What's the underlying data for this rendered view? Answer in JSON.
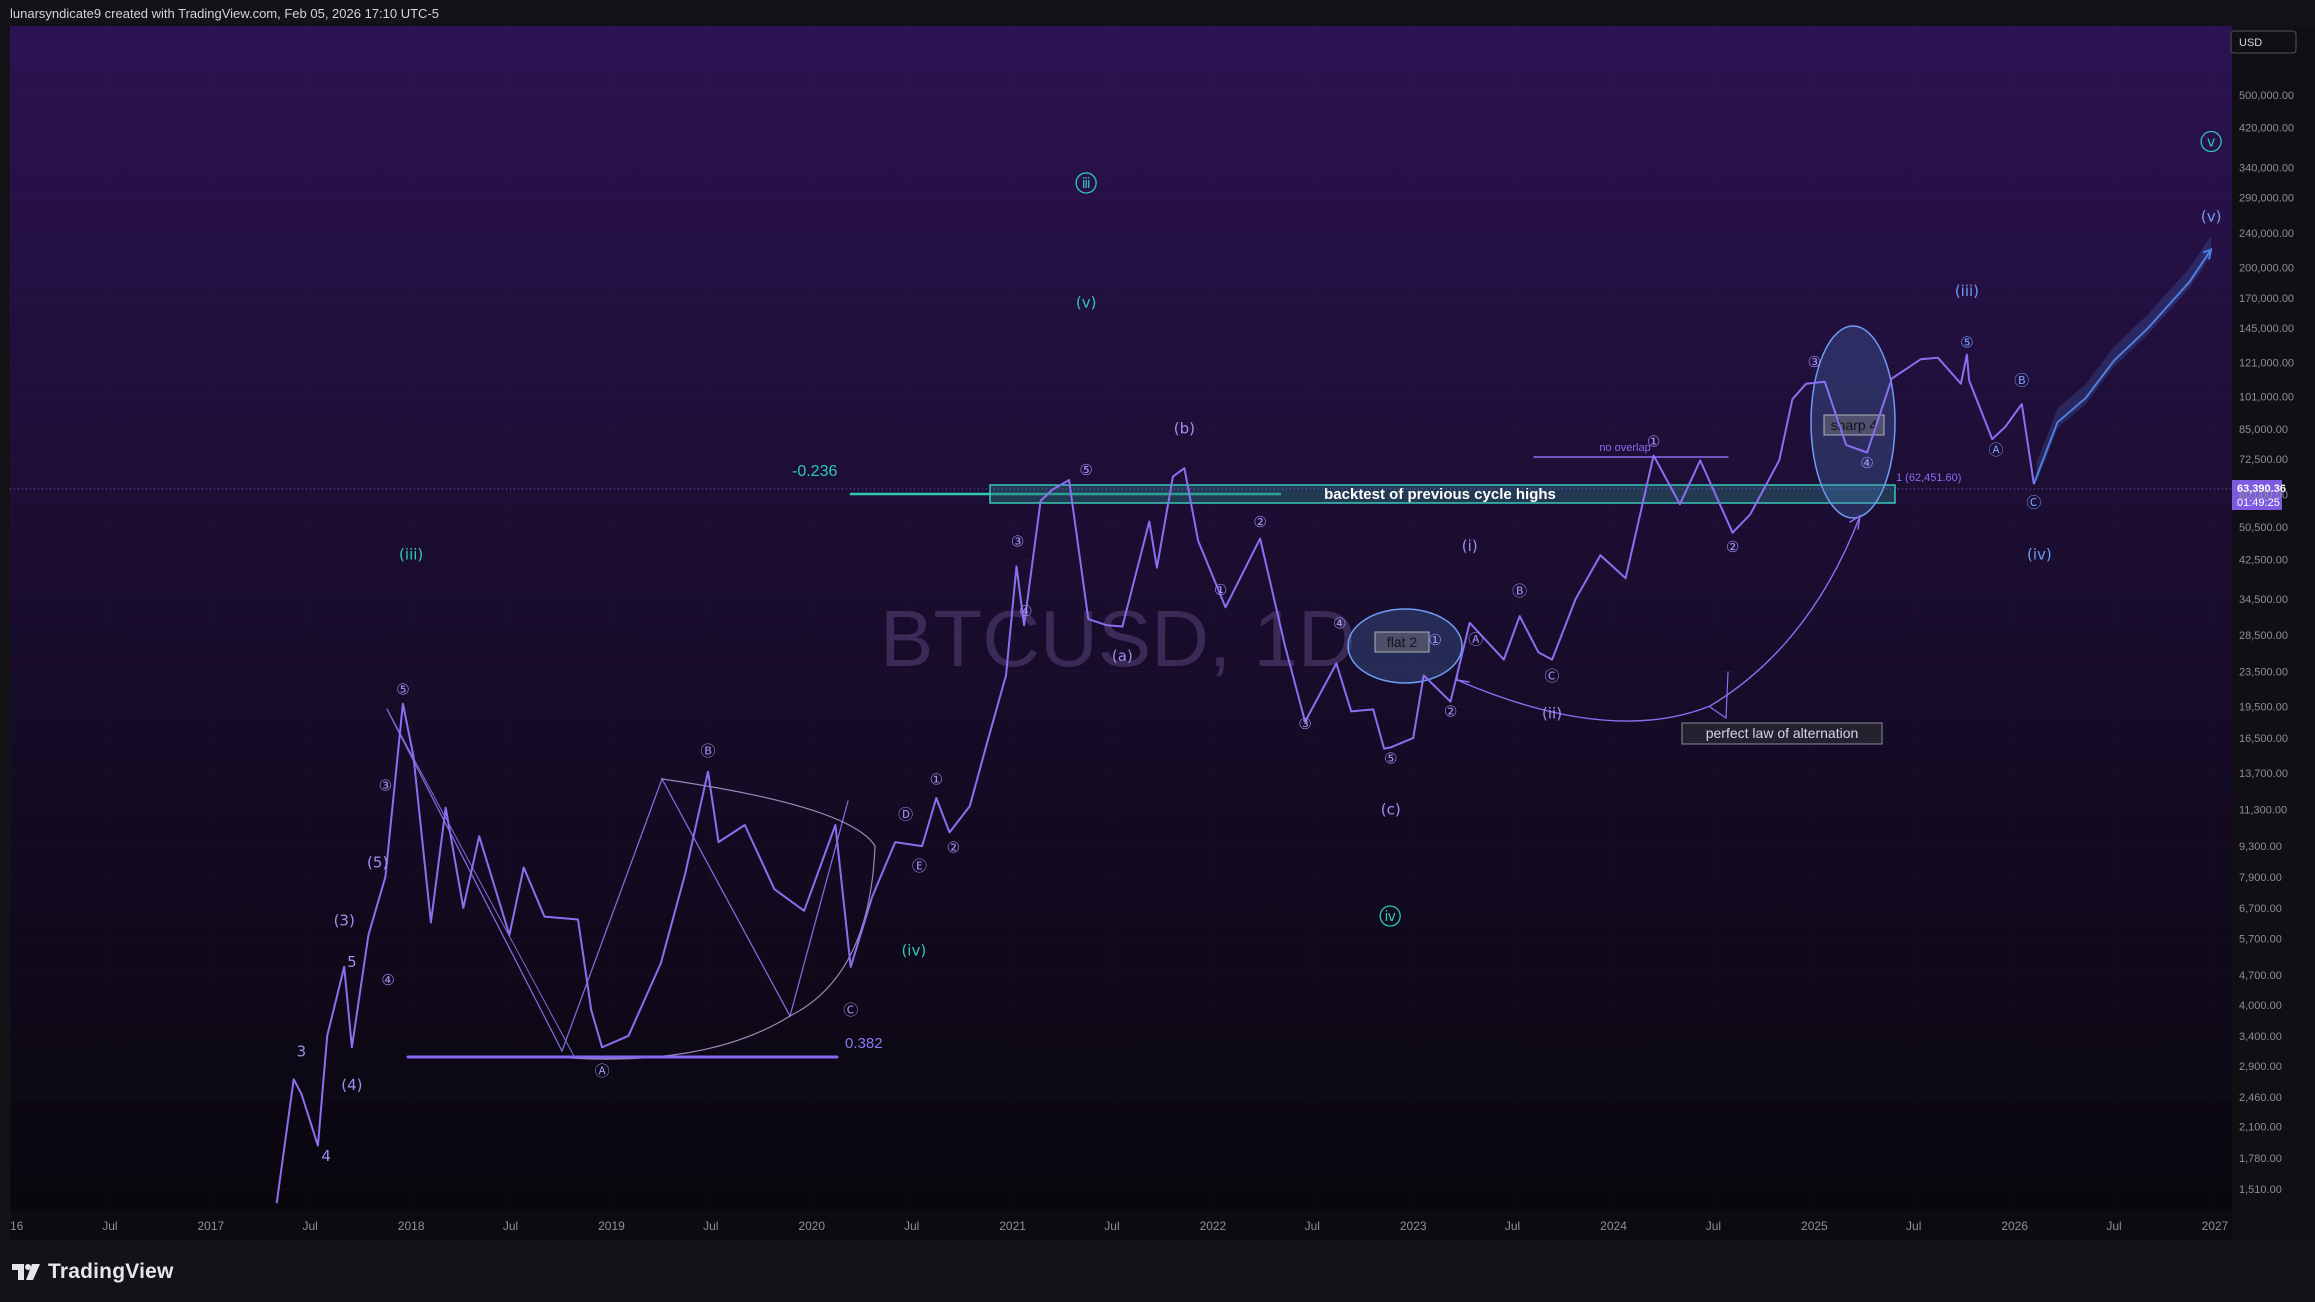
{
  "header": {
    "attribution": "lunarsyndicate9 created with TradingView.com, Feb 05, 2026 17:10 UTC-5"
  },
  "footer": {
    "brand": "TradingView"
  },
  "colors": {
    "bg_top": "#2c1252",
    "bg_bottom": "#08060c",
    "price_line": "#8a6ff0",
    "wave_purple": "#a08ef0",
    "wave_teal": "#2fc9b2",
    "wave_blue": "#6f9cf3",
    "price_badge": "#7c5be0",
    "ticker_watermark": "#3a2a55"
  },
  "chart_data": {
    "type": "line",
    "title": "BTCUSD, 1D",
    "currency": "USD",
    "y_scale": "log",
    "ylim": [
      1350,
      720000
    ],
    "x_range": [
      "2016-01-01",
      "2027-02-01"
    ],
    "x_tick_labels": [
      "2016",
      "Jul",
      "2017",
      "Jul",
      "2018",
      "Jul",
      "2019",
      "Jul",
      "2020",
      "Jul",
      "2021",
      "Jul",
      "2022",
      "Jul",
      "2023",
      "Jul",
      "2024",
      "Jul",
      "2025",
      "Jul",
      "2026",
      "Jul",
      "2027"
    ],
    "x_tick_dates": [
      "2016-01-01",
      "2016-07-01",
      "2017-01-01",
      "2017-07-01",
      "2018-01-01",
      "2018-07-01",
      "2019-01-01",
      "2019-07-01",
      "2020-01-01",
      "2020-07-01",
      "2021-01-01",
      "2021-07-01",
      "2022-01-01",
      "2022-07-01",
      "2023-01-01",
      "2023-07-01",
      "2024-01-01",
      "2024-07-01",
      "2025-01-01",
      "2025-07-01",
      "2026-01-01",
      "2026-07-01",
      "2027-01-01"
    ],
    "y_tick_labels": [
      "500,000.00",
      "420,000.00",
      "340,000.00",
      "290,000.00",
      "240,000.00",
      "200,000.00",
      "170,000.00",
      "145,000.00",
      "121,000.00",
      "101,000.00",
      "85,000.00",
      "72,500.00",
      "60,000.00",
      "50,500.00",
      "42,500.00",
      "34,500.00",
      "28,500.00",
      "23,500.00",
      "19,500.00",
      "16,500.00",
      "13,700.00",
      "11,300.00",
      "9,300.00",
      "7,900.00",
      "6,700.00",
      "5,700.00",
      "4,700.00",
      "4,000.00",
      "3,400.00",
      "2,900.00",
      "2,460.00",
      "2,100.00",
      "1,780.00",
      "1,510.00"
    ],
    "y_tick_values": [
      500000,
      420000,
      340000,
      290000,
      240000,
      200000,
      170000,
      145000,
      121000,
      101000,
      85000,
      72500,
      60000,
      50500,
      42500,
      34500,
      28500,
      23500,
      19500,
      16500,
      13700,
      11300,
      9300,
      7900,
      6700,
      5700,
      4700,
      4000,
      3400,
      2900,
      2460,
      2100,
      1780,
      1510
    ],
    "last_price": {
      "value": 63390.36,
      "label": "63,390.36",
      "countdown": "01:49:25"
    },
    "series": [
      {
        "dates": [
          "2017-05-01",
          "2017-06-01",
          "2017-06-15",
          "2017-07-15",
          "2017-08-01",
          "2017-09-01",
          "2017-09-15",
          "2017-10-15",
          "2017-11-15",
          "2017-12-17",
          "2018-01-05",
          "2018-02-06",
          "2018-03-05",
          "2018-04-06",
          "2018-05-05",
          "2018-06-29",
          "2018-07-25",
          "2018-09-01",
          "2018-11-01",
          "2018-11-25",
          "2018-12-15",
          "2019-02-01",
          "2019-04-01",
          "2019-05-15",
          "2019-06-26",
          "2019-07-15",
          "2019-09-01",
          "2019-10-25",
          "2019-12-18",
          "2020-02-13",
          "2020-03-12",
          "2020-04-20",
          "2020-06-01",
          "2020-07-20",
          "2020-08-15",
          "2020-09-08",
          "2020-10-15",
          "2020-11-15",
          "2020-12-20",
          "2021-01-08",
          "2021-01-22",
          "2021-02-21",
          "2021-03-14",
          "2021-04-14",
          "2021-05-19",
          "2021-06-22",
          "2021-07-20",
          "2021-09-07",
          "2021-09-21",
          "2021-10-20",
          "2021-11-10",
          "2021-12-05",
          "2022-01-24",
          "2022-03-28",
          "2022-05-12",
          "2022-06-18",
          "2022-08-14",
          "2022-09-10",
          "2022-10-20",
          "2022-11-09",
          "2022-11-21",
          "2023-01-01",
          "2023-01-20",
          "2023-03-10",
          "2023-04-14",
          "2023-06-15",
          "2023-07-14",
          "2023-08-17",
          "2023-09-11",
          "2023-10-24",
          "2023-12-08",
          "2024-01-23",
          "2024-03-14",
          "2024-05-01",
          "2024-06-07",
          "2024-08-05",
          "2024-09-06",
          "2024-10-29",
          "2024-11-22",
          "2024-12-17",
          "2025-01-20",
          "2025-02-28",
          "2025-04-07",
          "2025-05-22",
          "2025-07-14",
          "2025-08-14",
          "2025-09-25",
          "2025-10-06",
          "2025-10-10",
          "2025-11-21",
          "2025-12-15",
          "2026-01-14",
          "2026-02-05"
        ],
        "values": [
          1400,
          2700,
          2500,
          1900,
          3400,
          4900,
          3200,
          5800,
          7900,
          19800,
          15000,
          6200,
          11400,
          6700,
          9800,
          5800,
          8300,
          6400,
          6300,
          3900,
          3200,
          3400,
          5000,
          8000,
          13800,
          9500,
          10400,
          7400,
          6600,
          10400,
          4900,
          7100,
          9500,
          9300,
          12000,
          10000,
          11500,
          16000,
          23000,
          41000,
          30000,
          58000,
          61500,
          64800,
          31000,
          30000,
          29800,
          52000,
          40700,
          66000,
          69000,
          47000,
          33000,
          47500,
          27000,
          18000,
          24500,
          19000,
          19200,
          15600,
          15700,
          16500,
          23000,
          20000,
          30400,
          25000,
          31500,
          26000,
          25000,
          34500,
          43500,
          38500,
          73800,
          57000,
          71900,
          49000,
          54000,
          72000,
          99500,
          108000,
          109100,
          78000,
          75000,
          111000,
          123000,
          124000,
          108000,
          126000,
          110000,
          80500,
          86000,
          97000,
          63390
        ]
      }
    ],
    "forecast_projection": {
      "dates": [
        "2026-02-10",
        "2026-03-20",
        "2026-05-10",
        "2026-07-01",
        "2026-09-01",
        "2026-11-15",
        "2026-12-25"
      ],
      "values": [
        66000,
        88000,
        100000,
        122000,
        145000,
        185000,
        220000
      ]
    },
    "levels": [
      {
        "label": "-0.236",
        "value": 62400
      },
      {
        "label": "0.382",
        "value": 3200
      },
      {
        "label": "1 (62,451.60)",
        "value": 62451.6
      }
    ],
    "annotations": [
      "backtest of previous cycle highs",
      "flat 2",
      "sharp 4",
      "no overlap",
      "perfect law of alternation"
    ],
    "wave_labels": [
      {
        "text": "ⅲ",
        "date": "2021-05-15",
        "value": 305000,
        "style": "circle",
        "color": "teal"
      },
      {
        "text": "(v)",
        "date": "2021-05-15",
        "value": 162000,
        "style": "plain",
        "color": "teal"
      },
      {
        "text": "(iii)",
        "date": "2018-01-01",
        "value": 42500,
        "style": "plain",
        "color": "teal"
      },
      {
        "text": "(iv)",
        "date": "2020-07-05",
        "value": 5200,
        "style": "plain",
        "color": "teal"
      },
      {
        "text": "ⅳ",
        "date": "2022-11-20",
        "value": 6250,
        "style": "circle",
        "color": "teal"
      },
      {
        "text": "ⅴ",
        "date": "2026-12-25",
        "value": 380000,
        "style": "circle",
        "color": "teal"
      },
      {
        "text": "(b)",
        "date": "2021-11-10",
        "value": 83000,
        "style": "plain",
        "color": "purple"
      },
      {
        "text": "(a)",
        "date": "2021-07-20",
        "value": 24800,
        "style": "plain",
        "color": "purple"
      },
      {
        "text": "(c)",
        "date": "2022-11-21",
        "value": 11000,
        "style": "plain",
        "color": "purple"
      },
      {
        "text": "(i)",
        "date": "2023-04-14",
        "value": 44500,
        "style": "plain",
        "color": "purple"
      },
      {
        "text": "(ii)",
        "date": "2023-09-11",
        "value": 18300,
        "style": "plain",
        "color": "purple"
      },
      {
        "text": "(iii)",
        "date": "2025-10-06",
        "value": 172000,
        "style": "plain",
        "color": "blue"
      },
      {
        "text": "(iv)",
        "date": "2026-02-15",
        "value": 42500,
        "style": "plain",
        "color": "blue"
      },
      {
        "text": "(v)",
        "date": "2026-12-25",
        "value": 255000,
        "style": "plain",
        "color": "blue"
      },
      {
        "text": "⑤",
        "date": "2017-12-17",
        "value": 20800,
        "style": "plain",
        "color": "purple"
      },
      {
        "text": "③",
        "date": "2017-11-15",
        "value": 12500,
        "style": "plain",
        "color": "purple"
      },
      {
        "text": "(5)",
        "date": "2017-11-01",
        "value": 8300,
        "style": "plain",
        "color": "purple"
      },
      {
        "text": "(3)",
        "date": "2017-09-01",
        "value": 6100,
        "style": "plain",
        "color": "purple"
      },
      {
        "text": "5",
        "date": "2017-09-15",
        "value": 4900,
        "style": "plain",
        "color": "purple"
      },
      {
        "text": "④",
        "date": "2017-11-20",
        "value": 4450,
        "style": "plain",
        "color": "purple"
      },
      {
        "text": "3",
        "date": "2017-06-15",
        "value": 3050,
        "style": "plain",
        "color": "purple"
      },
      {
        "text": "(4)",
        "date": "2017-09-15",
        "value": 2550,
        "style": "plain",
        "color": "purple"
      },
      {
        "text": "4",
        "date": "2017-07-30",
        "value": 1750,
        "style": "plain",
        "color": "purple"
      },
      {
        "text": "Ⓐ",
        "date": "2018-12-15",
        "value": 2750,
        "style": "plain",
        "color": "purple"
      },
      {
        "text": "Ⓑ",
        "date": "2019-06-26",
        "value": 15000,
        "style": "plain",
        "color": "purple"
      },
      {
        "text": "Ⓒ",
        "date": "2020-03-12",
        "value": 3800,
        "style": "plain",
        "color": "purple"
      },
      {
        "text": "Ⓓ",
        "date": "2020-06-20",
        "value": 10700,
        "style": "plain",
        "color": "purple"
      },
      {
        "text": "Ⓔ",
        "date": "2020-07-15",
        "value": 8150,
        "style": "plain",
        "color": "purple"
      },
      {
        "text": "①",
        "date": "2020-08-15",
        "value": 12900,
        "style": "plain",
        "color": "purple"
      },
      {
        "text": "②",
        "date": "2020-09-15",
        "value": 9000,
        "style": "plain",
        "color": "purple"
      },
      {
        "text": "③",
        "date": "2021-01-10",
        "value": 45500,
        "style": "plain",
        "color": "purple"
      },
      {
        "text": "④",
        "date": "2021-01-25",
        "value": 31500,
        "style": "plain",
        "color": "purple"
      },
      {
        "text": "⑤",
        "date": "2021-05-15",
        "value": 66500,
        "style": "plain",
        "color": "purple"
      },
      {
        "text": "②",
        "date": "2022-03-28",
        "value": 50500,
        "style": "plain",
        "color": "purple"
      },
      {
        "text": "①",
        "date": "2022-01-15",
        "value": 35200,
        "style": "plain",
        "color": "purple"
      },
      {
        "text": "③",
        "date": "2022-06-18",
        "value": 17300,
        "style": "plain",
        "color": "purple"
      },
      {
        "text": "④",
        "date": "2022-08-20",
        "value": 29500,
        "style": "plain",
        "color": "purple"
      },
      {
        "text": "⑤",
        "date": "2022-11-21",
        "value": 14400,
        "style": "plain",
        "color": "purple"
      },
      {
        "text": "②",
        "date": "2023-03-10",
        "value": 18500,
        "style": "plain",
        "color": "purple"
      },
      {
        "text": "①",
        "date": "2023-02-10",
        "value": 27000,
        "style": "plain",
        "color": "purple"
      },
      {
        "text": "Ⓐ",
        "date": "2023-04-25",
        "value": 27100,
        "style": "plain",
        "color": "purple"
      },
      {
        "text": "Ⓑ",
        "date": "2023-07-14",
        "value": 35000,
        "style": "plain",
        "color": "purple"
      },
      {
        "text": "Ⓒ",
        "date": "2023-09-11",
        "value": 22300,
        "style": "plain",
        "color": "purple"
      },
      {
        "text": "①",
        "date": "2024-03-14",
        "value": 77500,
        "style": "plain",
        "color": "purple"
      },
      {
        "text": "②",
        "date": "2024-08-05",
        "value": 44300,
        "style": "plain",
        "color": "purple"
      },
      {
        "text": "③",
        "date": "2025-01-01",
        "value": 118000,
        "style": "plain",
        "color": "purple"
      },
      {
        "text": "④",
        "date": "2025-04-07",
        "value": 69000,
        "style": "plain",
        "color": "purple"
      },
      {
        "text": "⑤",
        "date": "2025-10-06",
        "value": 131000,
        "style": "plain",
        "color": "blue"
      },
      {
        "text": "Ⓑ",
        "date": "2026-01-14",
        "value": 107000,
        "style": "plain",
        "color": "blue"
      },
      {
        "text": "Ⓐ",
        "date": "2025-11-28",
        "value": 74000,
        "style": "plain",
        "color": "blue"
      },
      {
        "text": "Ⓒ",
        "date": "2026-02-05",
        "value": 56000,
        "style": "plain",
        "color": "blue"
      }
    ]
  }
}
